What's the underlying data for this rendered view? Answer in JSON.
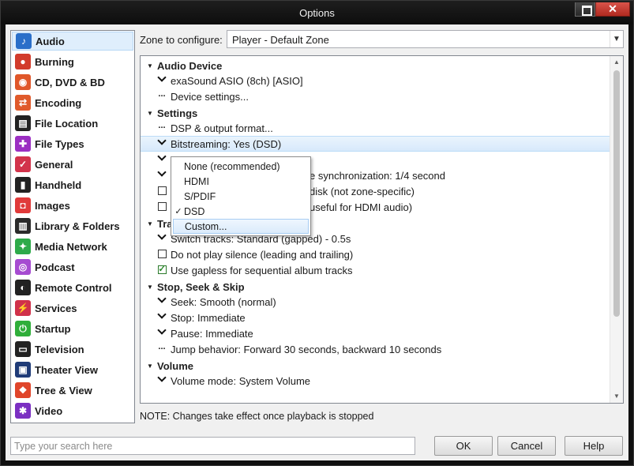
{
  "window": {
    "title": "Options"
  },
  "sidebar": {
    "items": [
      {
        "label": "Audio",
        "icon": "music-note-icon",
        "color": "#2a6fc9",
        "glyph": "♪",
        "selected": true
      },
      {
        "label": "Burning",
        "icon": "burn-disc-icon",
        "color": "#d23b2b",
        "glyph": "●"
      },
      {
        "label": "CD, DVD & BD",
        "icon": "disc-icon",
        "color": "#e0572a",
        "glyph": "◉"
      },
      {
        "label": "Encoding",
        "icon": "encoding-arrows-icon",
        "color": "#e05a2b",
        "glyph": "⇄"
      },
      {
        "label": "File Location",
        "icon": "file-location-icon",
        "color": "#222222",
        "glyph": "▤"
      },
      {
        "label": "File Types",
        "icon": "puzzle-icon",
        "color": "#9b2fc2",
        "glyph": "✚"
      },
      {
        "label": "General",
        "icon": "general-checkbox-icon",
        "color": "#d2334b",
        "glyph": "✓"
      },
      {
        "label": "Handheld",
        "icon": "handheld-icon",
        "color": "#222222",
        "glyph": "▮"
      },
      {
        "label": "Images",
        "icon": "camera-icon",
        "color": "#e03a3a",
        "glyph": "◘"
      },
      {
        "label": "Library & Folders",
        "icon": "library-icon",
        "color": "#2b2b2b",
        "glyph": "▥"
      },
      {
        "label": "Media Network",
        "icon": "network-icon",
        "color": "#2eaa4a",
        "glyph": "✦"
      },
      {
        "label": "Podcast",
        "icon": "podcast-icon",
        "color": "#a64bd1",
        "glyph": "◎"
      },
      {
        "label": "Remote Control",
        "icon": "remote-control-icon",
        "color": "#222222",
        "glyph": "◐"
      },
      {
        "label": "Services",
        "icon": "services-plug-icon",
        "color": "#d0314a",
        "glyph": "⚡"
      },
      {
        "label": "Startup",
        "icon": "power-icon",
        "color": "#2fae3a",
        "glyph": "⏻"
      },
      {
        "label": "Television",
        "icon": "television-icon",
        "color": "#222222",
        "glyph": "▭"
      },
      {
        "label": "Theater View",
        "icon": "theater-view-icon",
        "color": "#1f3b78",
        "glyph": "▣"
      },
      {
        "label": "Tree & View",
        "icon": "tree-view-icon",
        "color": "#e0452a",
        "glyph": "❖"
      },
      {
        "label": "Video",
        "icon": "video-camera-icon",
        "color": "#7b2fc2",
        "glyph": "✱"
      }
    ]
  },
  "zone": {
    "label": "Zone to configure:",
    "value": "Player - Default Zone"
  },
  "panel": {
    "rows": [
      {
        "kind": "section",
        "label": "Audio Device"
      },
      {
        "kind": "item",
        "marker": "chevron",
        "label": "exaSound ASIO (8ch) [ASIO]"
      },
      {
        "kind": "item",
        "marker": "dots",
        "label": "Device settings..."
      },
      {
        "kind": "section",
        "label": "Settings"
      },
      {
        "kind": "item",
        "marker": "dots",
        "label": "DSP & output format..."
      },
      {
        "kind": "item",
        "marker": "chevron",
        "label": "Bitstreaming: Yes (DSD)",
        "highlight": true
      },
      {
        "kind": "item",
        "marker": "chevron",
        "label": ""
      },
      {
        "kind": "item",
        "marker": "chevron",
        "label": "e synchronization: 1/4 second",
        "offset": 214
      },
      {
        "kind": "item",
        "marker": "checkbox",
        "checked": false,
        "label": "disk (not zone-specific)",
        "offset": 214
      },
      {
        "kind": "item",
        "marker": "checkbox",
        "checked": false,
        "label": "useful for HDMI audio)",
        "offset": 214
      },
      {
        "kind": "section",
        "label": "Tra"
      },
      {
        "kind": "item",
        "marker": "chevron",
        "label": "Switch tracks: Standard (gapped) - 0.5s"
      },
      {
        "kind": "item",
        "marker": "checkbox",
        "checked": false,
        "label": "Do not play silence (leading and trailing)"
      },
      {
        "kind": "item",
        "marker": "checkbox",
        "checked": true,
        "label": "Use gapless for sequential album tracks"
      },
      {
        "kind": "section",
        "label": "Stop, Seek & Skip"
      },
      {
        "kind": "item",
        "marker": "chevron",
        "label": "Seek: Smooth (normal)"
      },
      {
        "kind": "item",
        "marker": "chevron",
        "label": "Stop: Immediate"
      },
      {
        "kind": "item",
        "marker": "chevron",
        "label": "Pause: Immediate"
      },
      {
        "kind": "item",
        "marker": "dots",
        "label": "Jump behavior: Forward 30 seconds, backward 10 seconds"
      },
      {
        "kind": "section",
        "label": "Volume"
      },
      {
        "kind": "item",
        "marker": "chevron",
        "label": "Volume mode: System Volume"
      }
    ]
  },
  "popup": {
    "items": [
      {
        "label": "None (recommended)",
        "checked": false
      },
      {
        "label": "HDMI",
        "checked": false
      },
      {
        "label": "S/PDIF",
        "checked": false
      },
      {
        "label": "DSD",
        "checked": true
      },
      {
        "label": "Custom...",
        "checked": false,
        "hover": true
      }
    ]
  },
  "note": "NOTE: Changes take effect once playback is stopped",
  "search": {
    "placeholder": "Type your search here",
    "value": ""
  },
  "buttons": {
    "ok": "OK",
    "cancel": "Cancel",
    "help": "Help"
  }
}
